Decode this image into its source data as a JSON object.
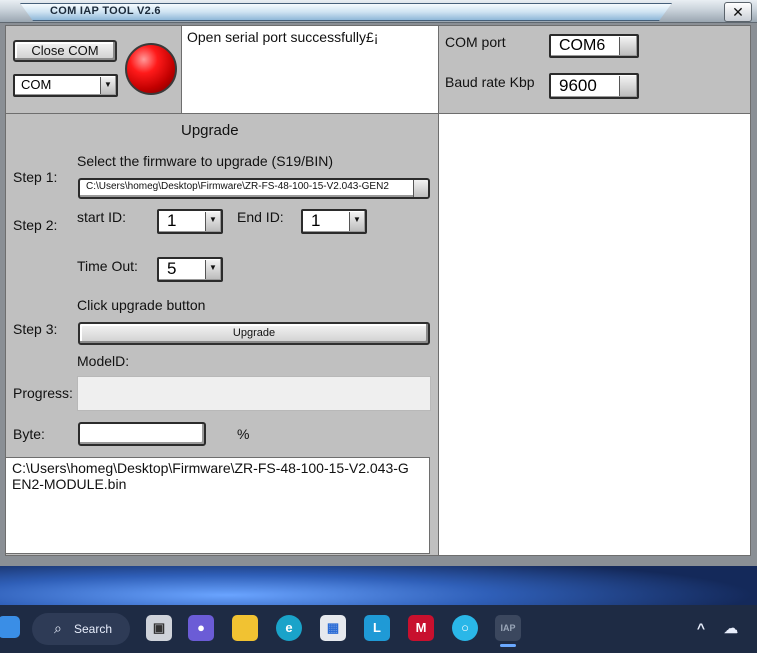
{
  "window": {
    "title": "COM IAP  TOOL V2.6",
    "close_glyph": "✕"
  },
  "top": {
    "close_com_label": "Close COM",
    "com_select_value": "COM",
    "status_message": "Open serial port successfully£¡",
    "com_port_label": "COM port",
    "com_port_value": "COM6",
    "baud_label": "Baud rate Kbp",
    "baud_value": "9600"
  },
  "upgrade": {
    "title": "Upgrade",
    "step1_label": "Step 1:",
    "step1_hint": "Select the firmware  to upgrade (S19/BIN)",
    "firmware_path": "C:\\Users\\homeg\\Desktop\\Firmware\\ZR-FS-48-100-15-V2.043-GEN2",
    "step2_label": "Step 2:",
    "start_id_label": "start ID:",
    "start_id_value": "1",
    "end_id_label": "End ID:",
    "end_id_value": "1",
    "timeout_label": "Time Out:",
    "timeout_value": "5",
    "step3_hint": "Click upgrade button",
    "step3_label": "Step 3:",
    "upgrade_button": "Upgrade",
    "model_id_label": "ModelD:",
    "progress_label": "Progress:",
    "progress_value": 0,
    "byte_label": "Byte:",
    "byte_value": "",
    "percent_sign": "%"
  },
  "log": {
    "text": "C:\\Users\\homeg\\Desktop\\Firmware\\ZR-FS-48-100-15-V2.043-GEN2-MODULE.bin"
  },
  "taskbar": {
    "search_label": "Search",
    "icons": [
      "start-icon",
      "search-icon",
      "task-view-icon",
      "meet-icon",
      "file-explorer-icon",
      "edge-icon",
      "store-icon",
      "l-app-icon",
      "mcafee-icon",
      "alexa-icon",
      "iap-tool-icon",
      "chevron-up-icon",
      "notification-icon"
    ]
  },
  "colors": {
    "panel": "#c0c0c0",
    "led": "#ff1a1a",
    "taskbar": "#1e2b44"
  }
}
